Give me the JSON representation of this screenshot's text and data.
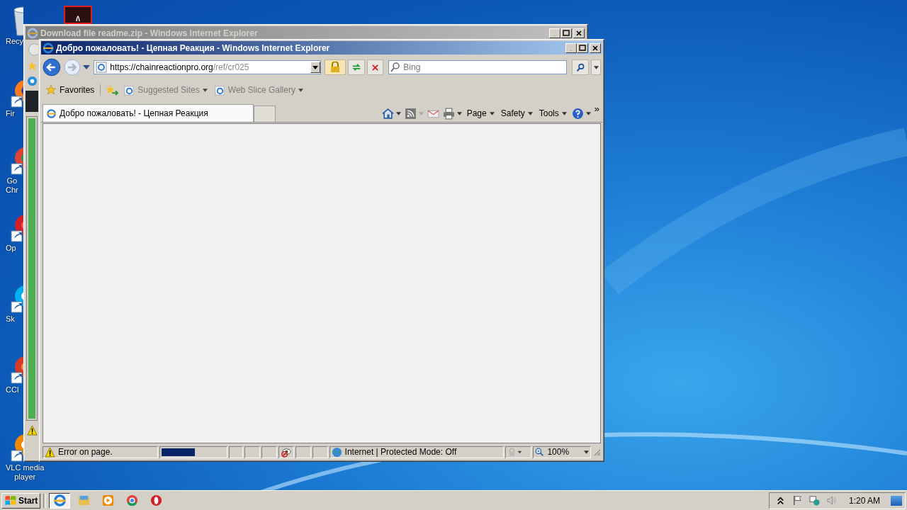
{
  "desktop": {
    "icons": [
      {
        "kind": "recycle",
        "lines": [
          "Recy"
        ]
      },
      {
        "kind": "firefox",
        "lines": [
          "Fir"
        ]
      },
      {
        "kind": "chrome",
        "lines": [
          "Go",
          "Chr"
        ]
      },
      {
        "kind": "opera",
        "lines": [
          "Op"
        ]
      },
      {
        "kind": "skype",
        "lines": [
          "Sk"
        ]
      },
      {
        "kind": "ccleaner",
        "lines": [
          "CCl"
        ]
      },
      {
        "kind": "vlc",
        "lines": [
          "VLC media",
          "player"
        ]
      }
    ]
  },
  "background_window": {
    "title": "Download file readme.zip - Windows Internet Explorer",
    "progress": {
      "level": 1
    }
  },
  "window": {
    "title": "Добро пожаловать! - Цепная Реакция - Windows Internet Explorer",
    "address": {
      "host": "https://chainreactionpro.org",
      "path": "/ref/cr025"
    },
    "search": {
      "placeholder": "Bing"
    },
    "favorites_bar": {
      "label": "Favorites",
      "links": [
        {
          "label": "Suggested Sites",
          "disabled": true
        },
        {
          "label": "Web Slice Gallery",
          "disabled": true
        }
      ]
    },
    "tabs": [
      {
        "label": "Добро пожаловать! - Цепная Реакция",
        "selected": true
      }
    ],
    "menus": [
      "Page",
      "Safety",
      "Tools"
    ],
    "overflow": "»"
  },
  "status_bar": {
    "message": "Error on page.",
    "progress": {
      "level": 0.52
    },
    "zone": "Internet | Protected Mode: Off",
    "zoom": "100%"
  },
  "taskbar": {
    "start": "Start",
    "apps": [
      {
        "kind": "ie",
        "selected": true
      },
      {
        "kind": "explorer",
        "selected": false
      },
      {
        "kind": "media",
        "selected": false
      },
      {
        "kind": "chrome",
        "selected": false
      },
      {
        "kind": "opera",
        "selected": false
      }
    ],
    "clock": "1:20 AM"
  }
}
